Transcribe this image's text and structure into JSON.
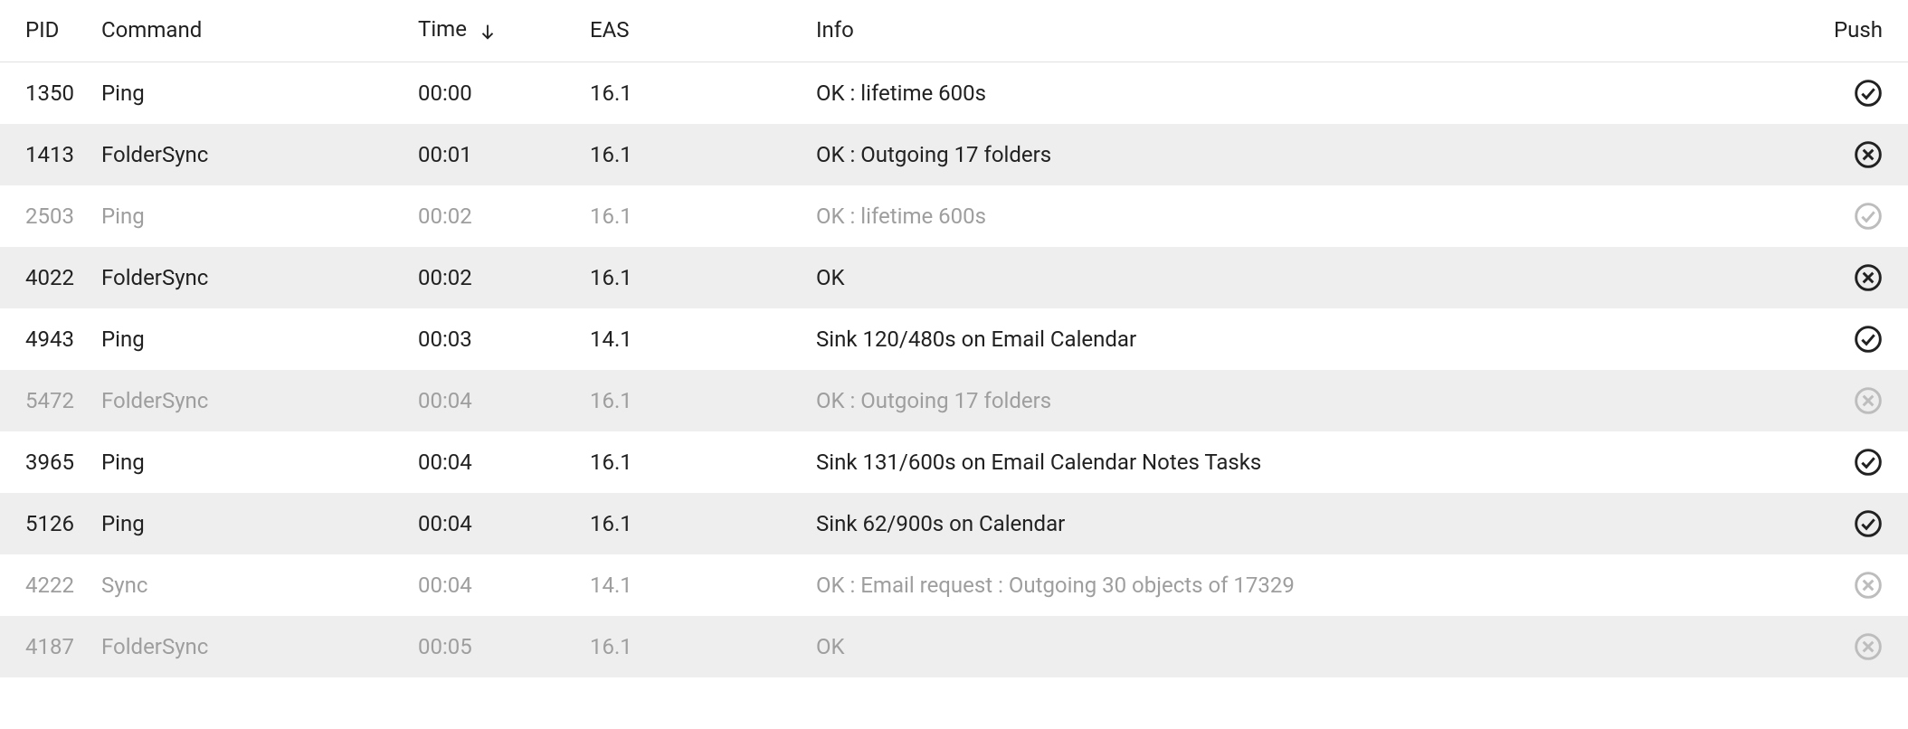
{
  "columns": {
    "pid": "PID",
    "command": "Command",
    "time": "Time",
    "eas": "EAS",
    "info": "Info",
    "push": "Push"
  },
  "sort": {
    "column": "time",
    "dir": "asc"
  },
  "rows": [
    {
      "pid": "1350",
      "command": "Ping",
      "time": "00:00",
      "eas": "16.1",
      "info": "OK : lifetime 600s",
      "push": "check",
      "dim": false
    },
    {
      "pid": "1413",
      "command": "FolderSync",
      "time": "00:01",
      "eas": "16.1",
      "info": "OK : Outgoing 17 folders",
      "push": "cross",
      "dim": false
    },
    {
      "pid": "2503",
      "command": "Ping",
      "time": "00:02",
      "eas": "16.1",
      "info": "OK : lifetime 600s",
      "push": "check",
      "dim": true
    },
    {
      "pid": "4022",
      "command": "FolderSync",
      "time": "00:02",
      "eas": "16.1",
      "info": "OK",
      "push": "cross",
      "dim": false
    },
    {
      "pid": "4943",
      "command": "Ping",
      "time": "00:03",
      "eas": "14.1",
      "info": "Sink 120/480s on Email Calendar",
      "push": "check",
      "dim": false
    },
    {
      "pid": "5472",
      "command": "FolderSync",
      "time": "00:04",
      "eas": "16.1",
      "info": "OK : Outgoing 17 folders",
      "push": "cross",
      "dim": true
    },
    {
      "pid": "3965",
      "command": "Ping",
      "time": "00:04",
      "eas": "16.1",
      "info": "Sink 131/600s on Email Calendar Notes Tasks",
      "push": "check",
      "dim": false
    },
    {
      "pid": "5126",
      "command": "Ping",
      "time": "00:04",
      "eas": "16.1",
      "info": "Sink 62/900s on Calendar",
      "push": "check",
      "dim": false
    },
    {
      "pid": "4222",
      "command": "Sync",
      "time": "00:04",
      "eas": "14.1",
      "info": "OK : Email request : Outgoing 30 objects of 17329",
      "push": "cross",
      "dim": true
    },
    {
      "pid": "4187",
      "command": "FolderSync",
      "time": "00:05",
      "eas": "16.1",
      "info": "OK",
      "push": "cross",
      "dim": true
    }
  ]
}
